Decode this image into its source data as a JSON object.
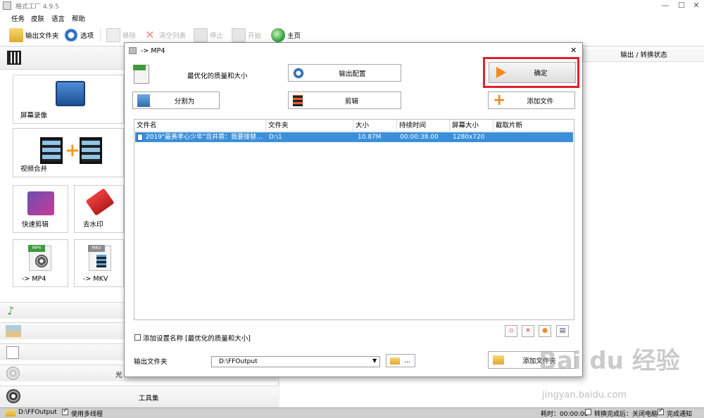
{
  "window": {
    "title": "格式工厂 4.9.5"
  },
  "menu": [
    "任务",
    "皮肤",
    "语言",
    "帮助"
  ],
  "toolbar": {
    "output_folder": "输出文件夹",
    "options": "选项",
    "remove": "移除",
    "clear_list": "清空列表",
    "stop": "停止",
    "start": "开始",
    "home": "主页"
  },
  "left": {
    "tiles": {
      "screen_record": "屏幕录像",
      "video_merge": "视频合并",
      "quick_clip": "快速剪辑",
      "watermark_remove": "去水印",
      "to_mp4": "-> MP4",
      "to_mkv": "-> MKV"
    },
    "mp4_badge": "MP4",
    "mkv_badge": "MKV",
    "categories": {
      "optical": "光",
      "toolbox": "工具集"
    }
  },
  "right": {
    "header": "输出 / 转换状态"
  },
  "dialog": {
    "title": "-> MP4",
    "quality": "最优化的质量和大小",
    "output_config": "输出配置",
    "ok": "确定",
    "split": "分割为",
    "clip": "剪辑",
    "add_file": "添加文件",
    "columns": [
      "文件名",
      "文件夹",
      "大小",
      "持续时间",
      "屏幕大小",
      "截取片断"
    ],
    "rows": [
      {
        "name": "2019\"最美孝心少年\"宫井蓉：我要接替...",
        "folder": "D:\\1",
        "size": "10.87M",
        "duration": "00:00:38.00",
        "screen": "1280x720",
        "clip": ""
      }
    ],
    "add_setting_name": "添加设置名称 [最优化的质量和大小]",
    "output_folder_label": "输出文件夹",
    "output_folder_value": "D:\\FFOutput",
    "browse": "...",
    "add_folder": "添加文件夹"
  },
  "status": {
    "path": "D:\\FFOutput",
    "multithread": "使用多线程",
    "elapsed": "耗时：00:00:00",
    "after_convert": "转换完成后：关闭电脑",
    "notify": "完成通知"
  },
  "watermark": {
    "logo": "Bai du 经验",
    "url": "jingyan.baidu.com"
  },
  "colors": {
    "highlight_row": "#3b8fd9",
    "ok_border": "#e0202a"
  }
}
